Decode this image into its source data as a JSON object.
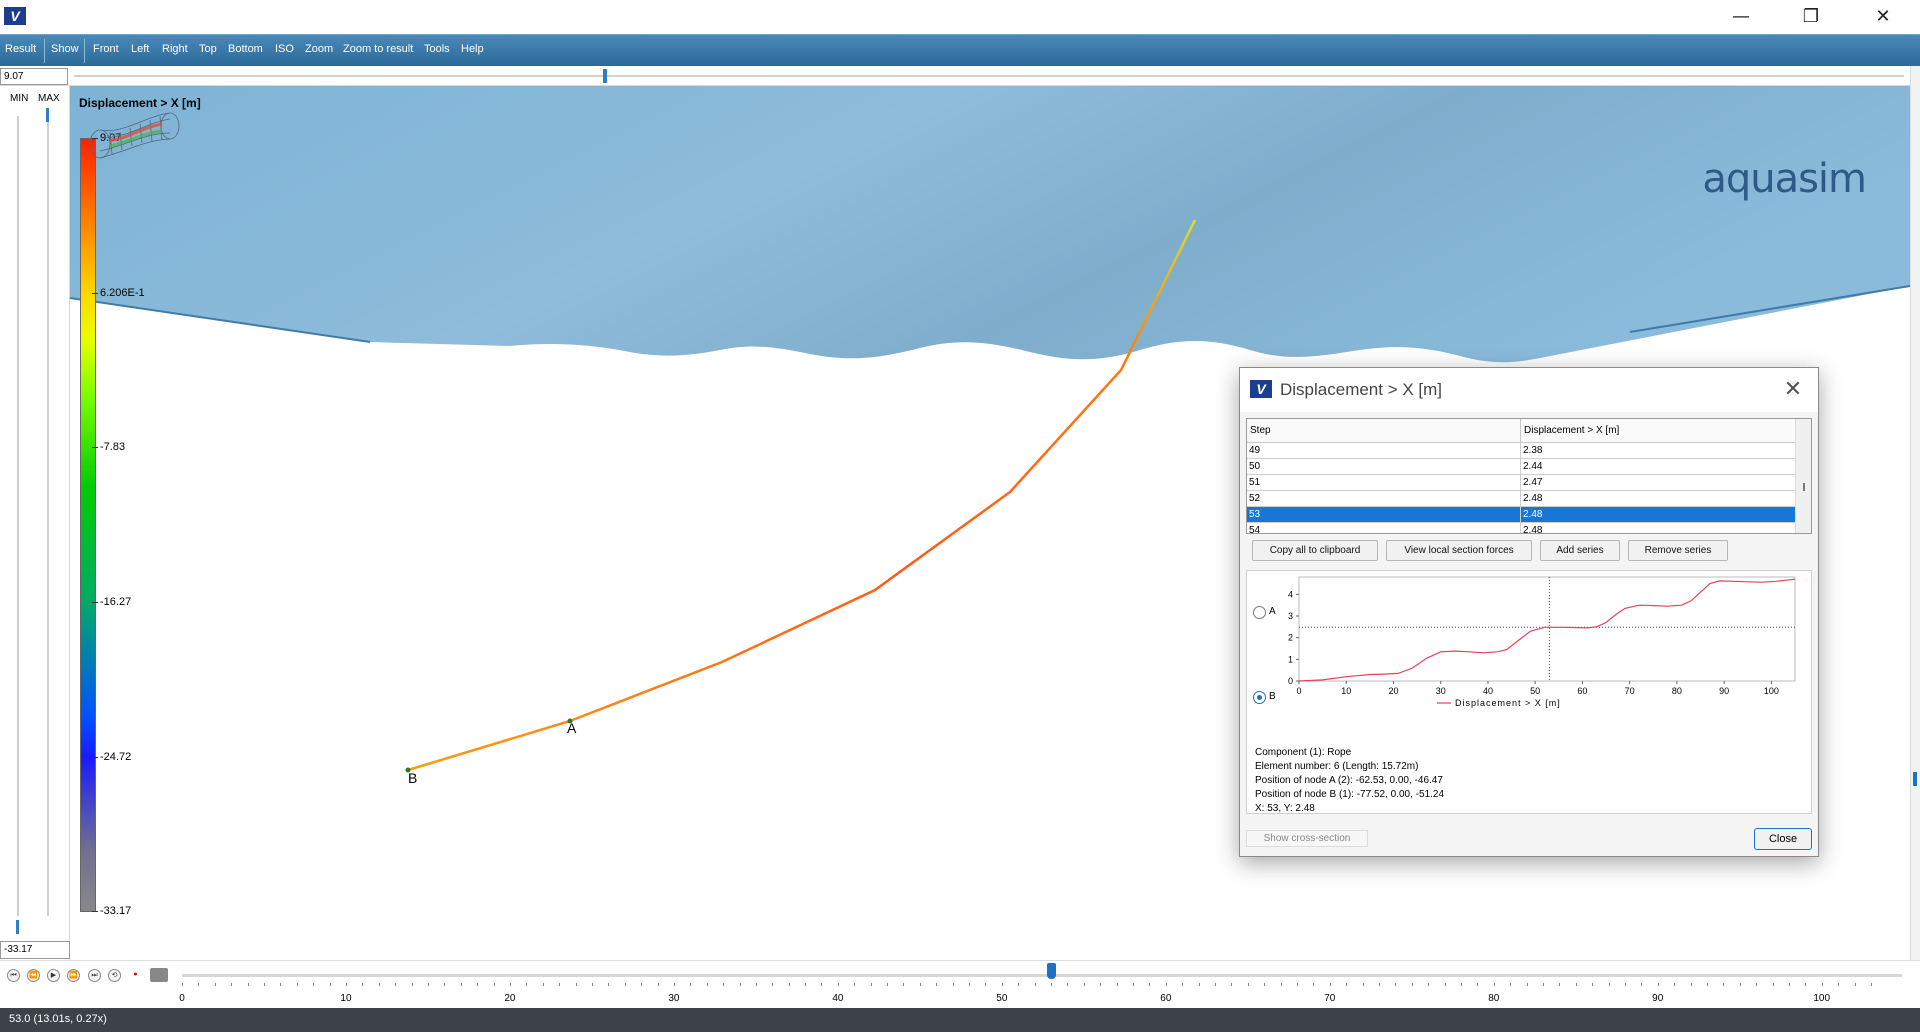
{
  "window": {
    "logo_text": "V",
    "minimize_glyph": "—",
    "maximize_glyph": "❐",
    "close_glyph": "✕"
  },
  "menu": {
    "items": [
      "Result",
      "Show",
      "Front",
      "Left",
      "Right",
      "Top",
      "Bottom",
      "ISO",
      "Zoom",
      "Zoom to result",
      "Tools",
      "Help"
    ]
  },
  "top_slider": {
    "value": "9.07"
  },
  "range_panel": {
    "min_label": "MIN",
    "max_label": "MAX",
    "bottom_value": "-33.17"
  },
  "legend": {
    "title": "Displacement > X [m]",
    "ticks": [
      "9.07",
      "6.206E-1",
      "-7.83",
      "-16.27",
      "-24.72",
      "-33.17"
    ]
  },
  "scene": {
    "node_labels": [
      "A",
      "B"
    ],
    "brand": "aquasim",
    "water_color": "#86b8d8",
    "rope_color": "#ff5a1a"
  },
  "timeline": {
    "buttons": [
      "⏮",
      "⏪",
      "▶",
      "⏩",
      "⏭",
      "⟲",
      "●",
      "cam"
    ],
    "ticks": [
      "0",
      "10",
      "20",
      "30",
      "40",
      "50",
      "60",
      "70",
      "80",
      "90",
      "100"
    ],
    "current_step": 53,
    "max_step": 103
  },
  "status": {
    "text": "53.0 (13.01s, 0.27x)"
  },
  "dialog": {
    "title": "Displacement > X [m]",
    "close_glyph": "✕",
    "table": {
      "headers": [
        "Step",
        "Displacement > X [m]"
      ],
      "rows": [
        [
          "49",
          "2.38"
        ],
        [
          "50",
          "2.44"
        ],
        [
          "51",
          "2.47"
        ],
        [
          "52",
          "2.48"
        ],
        [
          "53",
          "2.48"
        ],
        [
          "54",
          "2.48"
        ]
      ],
      "selected_row": 4
    },
    "buttons": {
      "copy": "Copy all to clipboard",
      "view_forces": "View local section forces",
      "add_series": "Add series",
      "remove_series": "Remove series",
      "show_cross": "Show cross-section",
      "close": "Close"
    },
    "radios": {
      "a": "A",
      "b": "B",
      "selected": "B"
    },
    "info": {
      "component": "Component (1): Rope",
      "element": "Element number: 6 (Length: 15.72m)",
      "node_a": "Position of node A (2): -62.53, 0.00, -46.47",
      "node_b": "Position of node B (1): -77.52, 0.00, -51.24",
      "xy": "X: 53, Y: 2.48"
    }
  },
  "chart_data": {
    "type": "line",
    "xlabel": "",
    "ylabel": "",
    "xlim": [
      0,
      105
    ],
    "ylim": [
      0,
      4.8
    ],
    "x_ticks": [
      "0",
      "10",
      "20",
      "30",
      "40",
      "50",
      "60",
      "70",
      "80",
      "90",
      "100"
    ],
    "y_ticks": [
      "0",
      "1",
      "2",
      "3",
      "4"
    ],
    "crosshair": {
      "x": 53,
      "y": 2.48
    },
    "series": [
      {
        "name": "Displacement > X [m]",
        "color": "#e8405a",
        "x": [
          0,
          5,
          10,
          15,
          18,
          21,
          24,
          27,
          30,
          33,
          36,
          39,
          42,
          44,
          46,
          49,
          52,
          55,
          58,
          61,
          63,
          65,
          67,
          69,
          72,
          75,
          78,
          81,
          83,
          85,
          87,
          89,
          92,
          95,
          98,
          101,
          105
        ],
        "y": [
          0.0,
          0.05,
          0.2,
          0.3,
          0.32,
          0.35,
          0.6,
          1.05,
          1.35,
          1.38,
          1.35,
          1.3,
          1.35,
          1.45,
          1.8,
          2.3,
          2.48,
          2.48,
          2.47,
          2.45,
          2.5,
          2.7,
          3.05,
          3.35,
          3.5,
          3.48,
          3.45,
          3.5,
          3.7,
          4.1,
          4.5,
          4.62,
          4.6,
          4.58,
          4.56,
          4.6,
          4.7
        ]
      }
    ]
  }
}
